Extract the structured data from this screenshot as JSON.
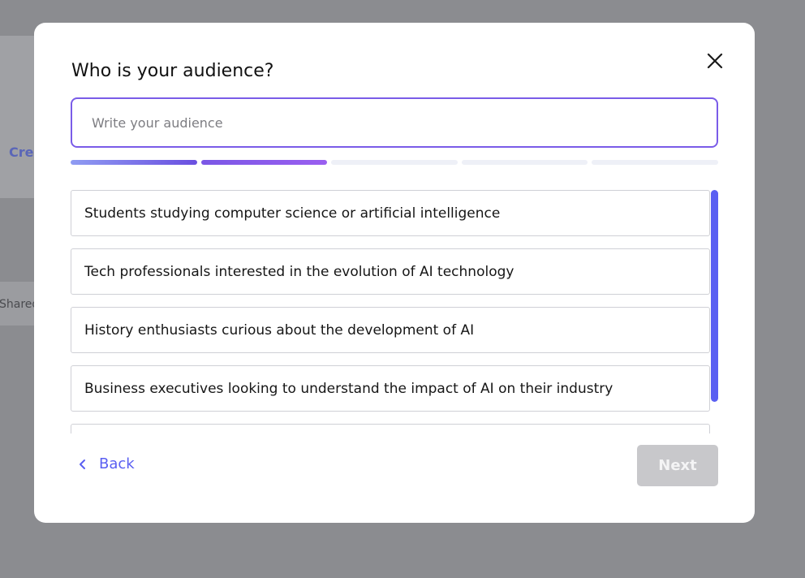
{
  "background": {
    "create_fragment": "Cre",
    "shared_fragment": "Shared"
  },
  "modal": {
    "title": "Who is your audience?",
    "input": {
      "value": "",
      "placeholder": "Write your audience"
    },
    "progress": {
      "total_steps": 5,
      "completed_steps": 2
    },
    "options": [
      "Students studying computer science or artificial intelligence",
      "Tech professionals interested in the evolution of AI technology",
      "History enthusiasts curious about the development of AI",
      "Business executives looking to understand the impact of AI on their industry",
      ""
    ],
    "back_label": "Back",
    "next_label": "Next"
  },
  "colors": {
    "accent": "#5a5ff2",
    "input_border": "#7a5ce8",
    "next_disabled_bg": "#c8c8cb",
    "overlay": "#8b8c90"
  }
}
